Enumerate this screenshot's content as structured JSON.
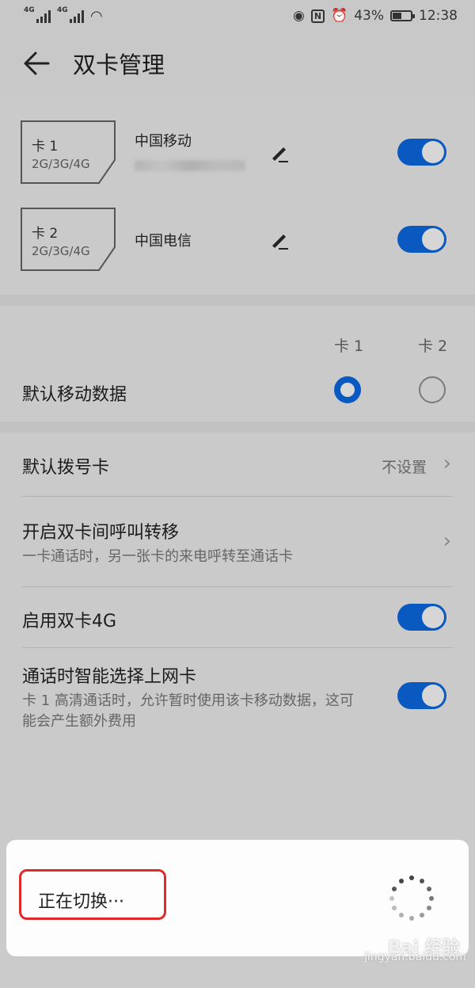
{
  "status_bar": {
    "left_signals": [
      "4G",
      "4G"
    ],
    "battery": "43%",
    "time": "12:38",
    "icons": [
      "eye-icon",
      "nfc-icon",
      "alarm-icon",
      "battery-icon",
      "wifi-icon"
    ]
  },
  "app_bar": {
    "title": "双卡管理"
  },
  "sims": [
    {
      "card_label": "卡 1",
      "types": "2G/3G/4G",
      "carrier": "中国移动",
      "enabled": true
    },
    {
      "card_label": "卡 2",
      "types": "2G/3G/4G",
      "carrier": "中国电信",
      "enabled": true
    }
  ],
  "default_data": {
    "label": "默认移动数据",
    "col1": "卡 1",
    "col2": "卡 2",
    "selected": "卡 1"
  },
  "settings": {
    "default_dial": {
      "label": "默认拨号卡",
      "value": "不设置"
    },
    "call_forward": {
      "label": "开启双卡间呼叫转移",
      "sub": "一卡通话时，另一张卡的来电呼转至通话卡"
    },
    "dual_4g": {
      "label": "启用双卡4G",
      "enabled": true
    },
    "smart_data": {
      "label": "通话时智能选择上网卡",
      "sub": "卡 1 高清通话时，允许暂时使用该卡移动数据，这可能会产生额外费用",
      "enabled": true
    }
  },
  "dialog": {
    "text": "正在切换···"
  },
  "watermark": {
    "logo": "Bai 经验",
    "url": "jingyan.baidu.com"
  },
  "colors": {
    "accent": "#0a59c0",
    "highlight": "#e02a2a"
  }
}
